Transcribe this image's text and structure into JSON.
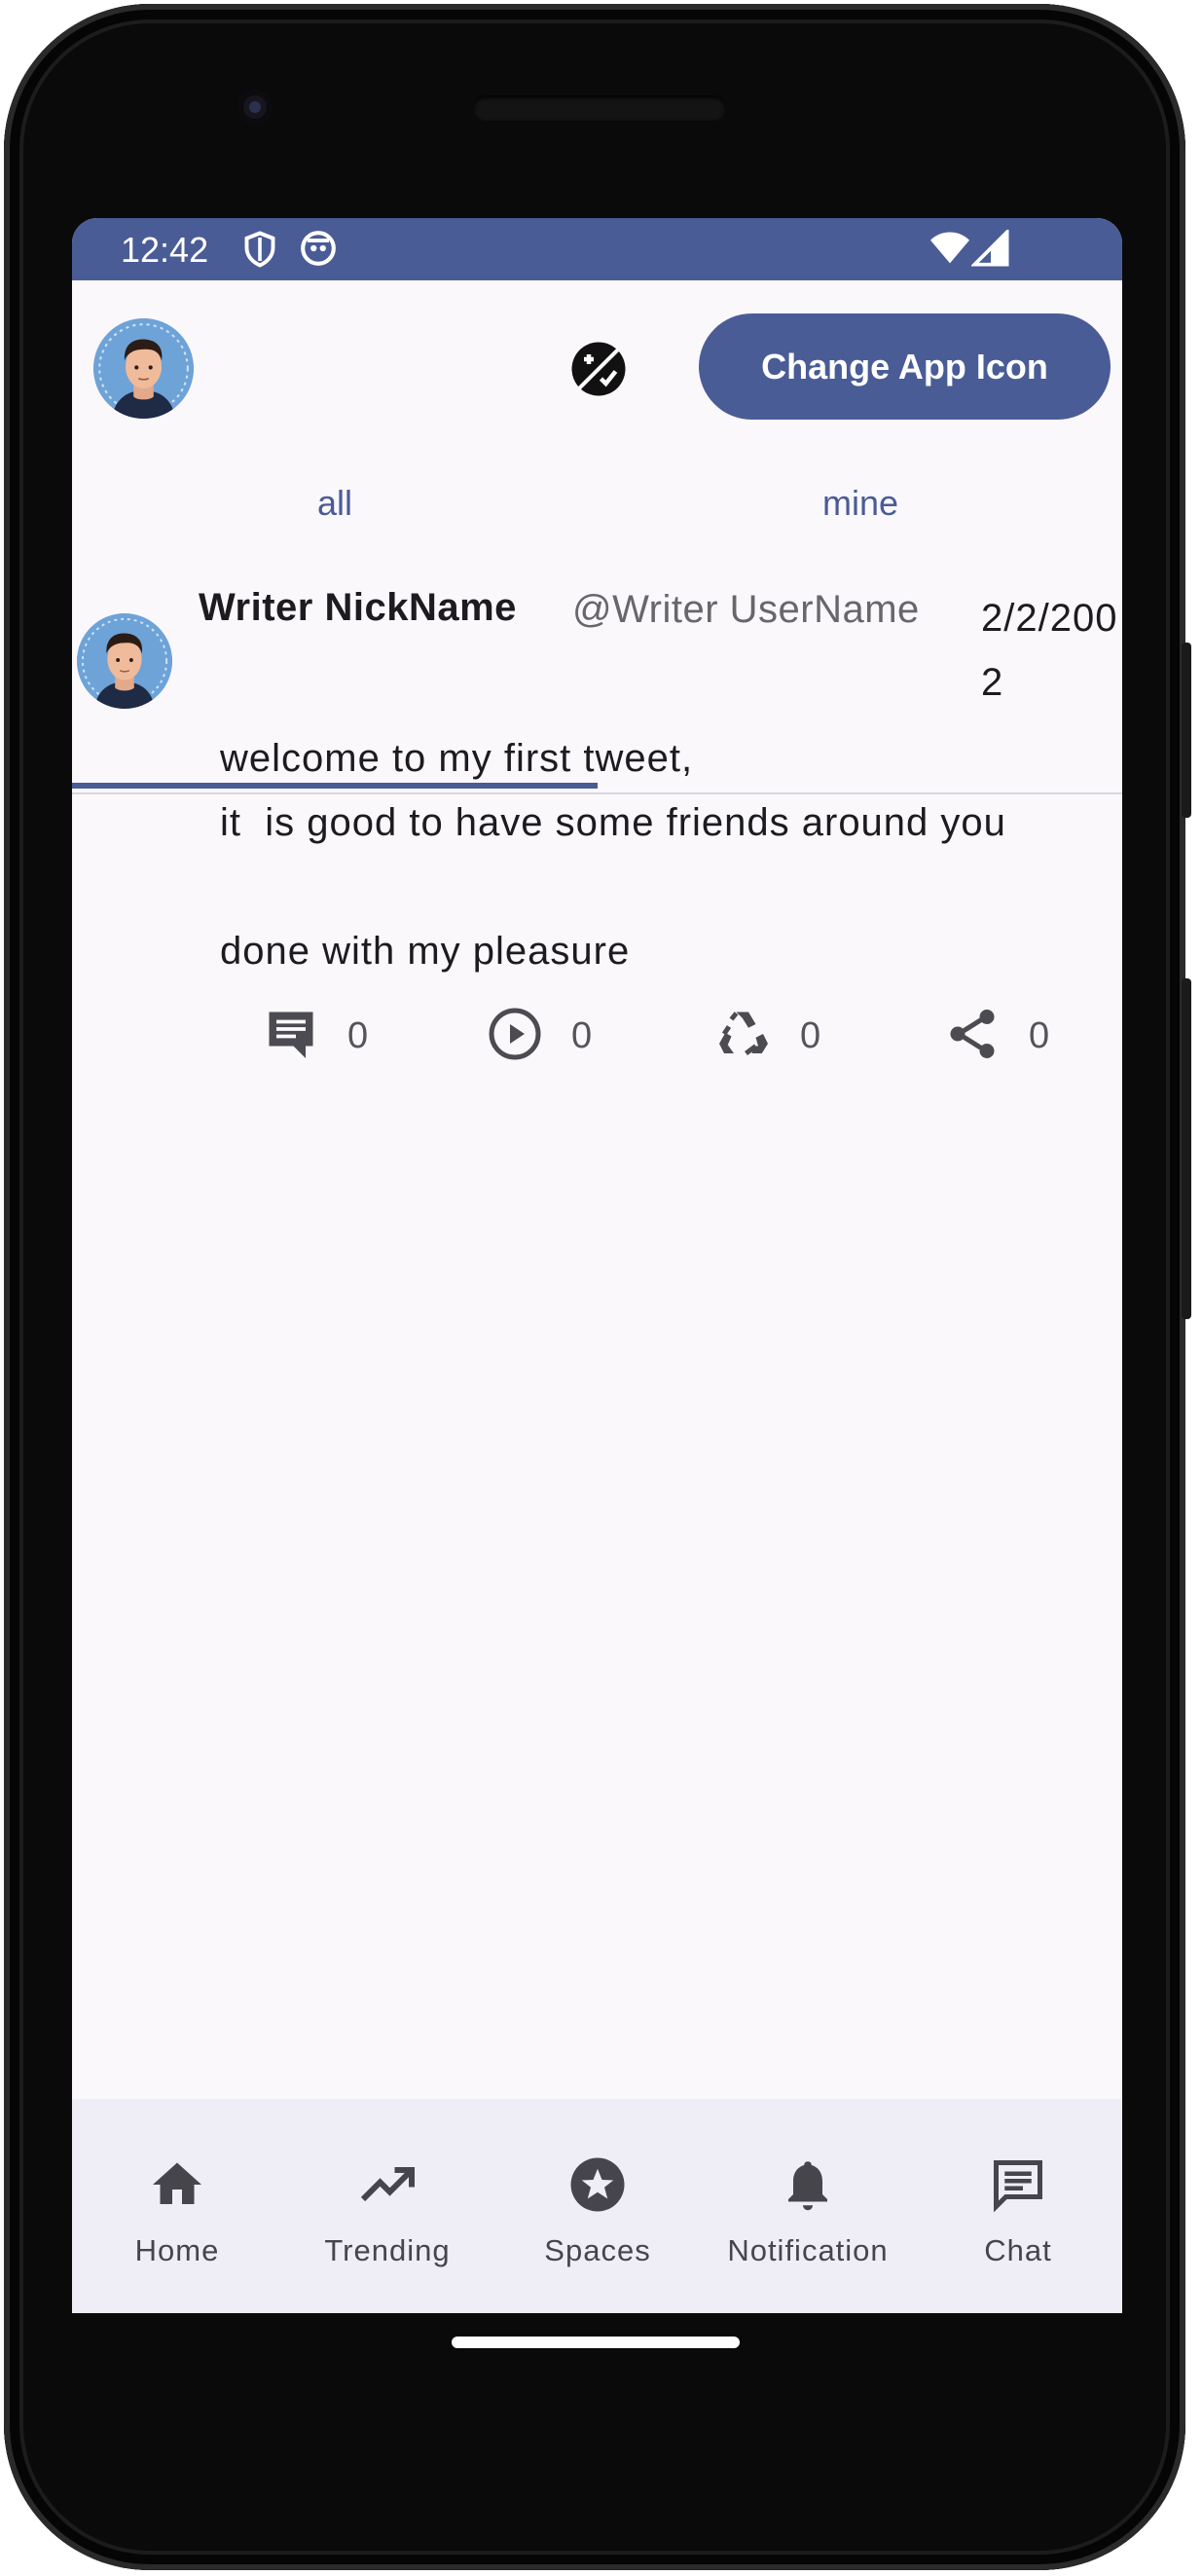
{
  "status_bar": {
    "time": "12:42",
    "icons": [
      "shield-icon",
      "notification-app-icon",
      "wifi-icon",
      "cell-signal-icon"
    ]
  },
  "header": {
    "change_icon_label": "Change App Icon",
    "theme_icon": "theme-toggle-icon"
  },
  "tabs": [
    {
      "label": "all",
      "selected": true
    },
    {
      "label": "mine",
      "selected": false
    }
  ],
  "tweet": {
    "nickname": "Writer NickName",
    "username": "@Writer UserName",
    "date": "2/2/2002",
    "body_lines": [
      "welcome to my first tweet,",
      "it  is good to have some friends around you",
      "",
      "done with my pleasure"
    ],
    "actions": [
      {
        "icon": "comment-icon",
        "count": "0"
      },
      {
        "icon": "play-icon",
        "count": "0"
      },
      {
        "icon": "recycle-icon",
        "count": "0"
      },
      {
        "icon": "share-icon",
        "count": "0"
      }
    ]
  },
  "bottom_nav": [
    {
      "label": "Home",
      "icon": "home-icon"
    },
    {
      "label": "Trending",
      "icon": "trending-icon"
    },
    {
      "label": "Spaces",
      "icon": "spaces-icon"
    },
    {
      "label": "Notification",
      "icon": "bell-icon"
    },
    {
      "label": "Chat",
      "icon": "chat-icon"
    }
  ],
  "colors": {
    "primary": "#4a5c96",
    "background": "#fbf8fc",
    "nav_background": "#efedf6",
    "text": "#1c1b1f",
    "secondary_text": "#67666c"
  }
}
